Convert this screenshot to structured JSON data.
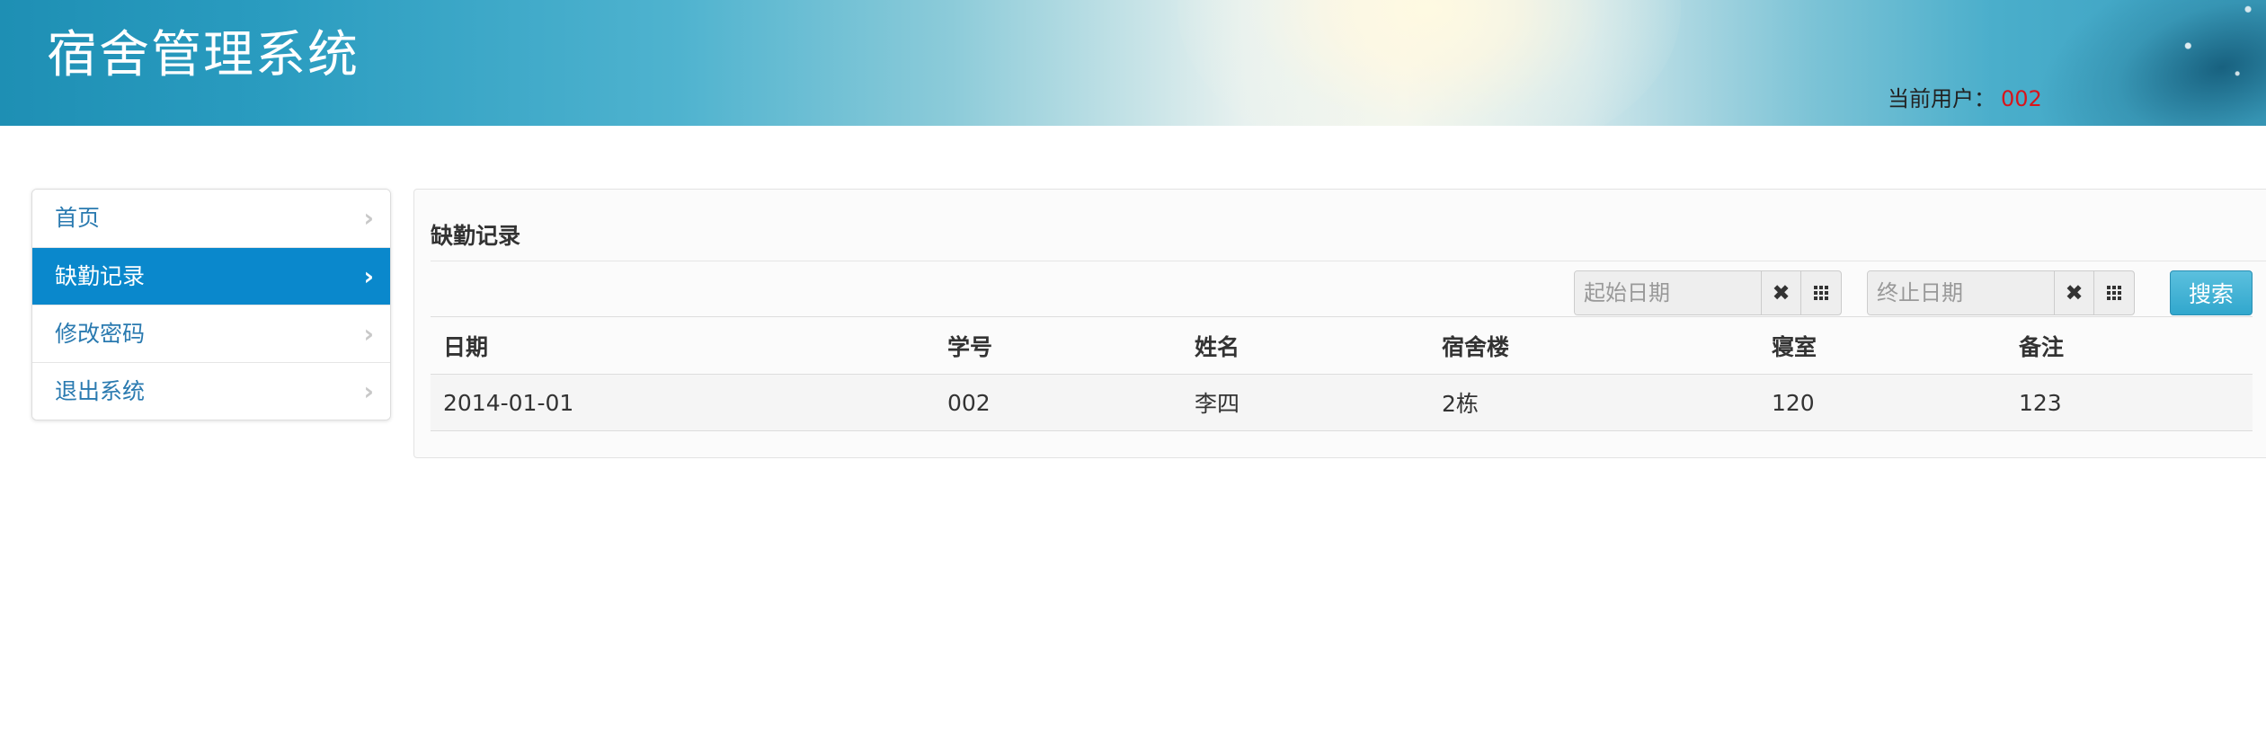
{
  "header": {
    "title": "宿舍管理系统",
    "user_label": "当前用户：",
    "user_id": "002"
  },
  "sidebar": {
    "items": [
      {
        "label": "首页",
        "active": false
      },
      {
        "label": "缺勤记录",
        "active": true
      },
      {
        "label": "修改密码",
        "active": false
      },
      {
        "label": "退出系统",
        "active": false
      }
    ]
  },
  "panel": {
    "title": "缺勤记录"
  },
  "search": {
    "start_placeholder": "起始日期",
    "end_placeholder": "终止日期",
    "clear_icon": "times-icon",
    "calendar_icon": "th-grid-icon",
    "button_label": "搜索"
  },
  "table": {
    "columns": [
      "日期",
      "学号",
      "姓名",
      "宿舍楼",
      "寝室",
      "备注"
    ],
    "rows": [
      [
        "2014-01-01",
        "002",
        "李四",
        "2栋",
        "120",
        "123"
      ]
    ]
  },
  "colors": {
    "active_nav": "#0a88cc",
    "link": "#2a7ab0",
    "user_id": "#d9141a",
    "search_button": "#31a7cd"
  }
}
